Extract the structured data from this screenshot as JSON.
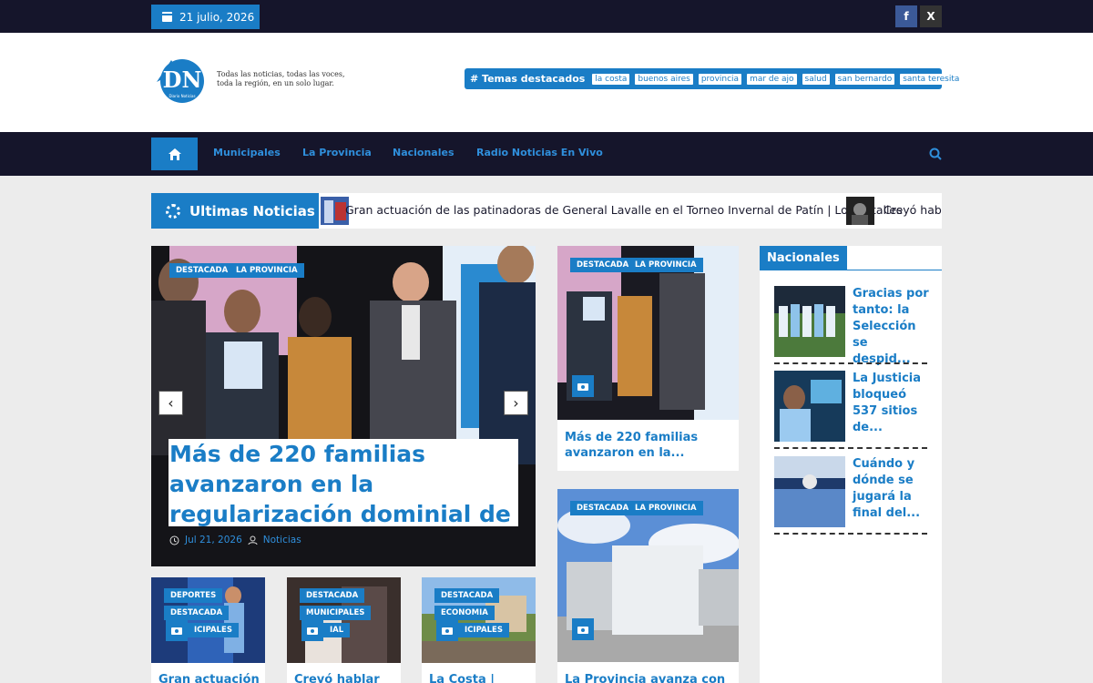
{
  "topbar": {
    "date": "21 julio, 2026",
    "social": [
      {
        "icon": "facebook-icon",
        "label": "f"
      },
      {
        "icon": "x-icon",
        "label": "X"
      }
    ]
  },
  "header": {
    "logo_text": "DN",
    "logo_sub": "Diario Noticias",
    "tagline_1": "Todas las noticias, todas las voces,",
    "tagline_2": "toda la región, en un solo lugar.",
    "temas_title": "# Temas destacados",
    "tags": [
      "la costa",
      "buenos aires",
      "provincia",
      "mar de ajo",
      "salud",
      "san bernardo",
      "santa teresita"
    ]
  },
  "nav": {
    "items": [
      "Municipales",
      "La Provincia",
      "Nacionales",
      "Radio Noticias En Vivo"
    ]
  },
  "ticker": {
    "title": "Ultimas Noticias",
    "items": [
      "Gran actuación de las patinadoras de General Lavalle en el Torneo Invernal de Patín | Los detalles",
      "Creyó habla"
    ]
  },
  "slider": {
    "categories": [
      "DESTACADA",
      "LA PROVINCIA"
    ],
    "title": "Más de 220 familias avanzaron en la regularización dominial de",
    "date": "Jul 21, 2026",
    "author": "Noticias",
    "prev": "‹",
    "next": "›"
  },
  "cards_right": [
    {
      "categories": [
        "DESTACADA",
        "LA PROVINCIA"
      ],
      "title_1": "Más de 220 familias",
      "title_2": "avanzaron en la..."
    },
    {
      "categories": [
        "DESTACADA",
        "LA PROVINCIA"
      ],
      "title_1": "La Provincia avanza con el",
      "title_2": ""
    }
  ],
  "cards_bottom": [
    {
      "categories": [
        "DEPORTES",
        "DESTACADA",
        "ICIPALES"
      ],
      "title": "Gran actuación"
    },
    {
      "categories": [
        "DESTACADA",
        "MUNICIPALES",
        "IAL"
      ],
      "title": "Creyó hablar"
    },
    {
      "categories": [
        "DESTACADA",
        "ECONOMIA",
        "ICIPALES"
      ],
      "title": "La Costa |"
    }
  ],
  "sidebar": {
    "title": "Nacionales",
    "items": [
      {
        "l1": "Gracias por",
        "l2": "tanto: la",
        "l3": "Selección",
        "l4": "se despid..."
      },
      {
        "l1": "La Justicia",
        "l2": "bloqueó",
        "l3": "537 sitios",
        "l4": "de..."
      },
      {
        "l1": "Cuándo y",
        "l2": "dónde se",
        "l3": "jugará la",
        "l4": "final del..."
      }
    ]
  }
}
